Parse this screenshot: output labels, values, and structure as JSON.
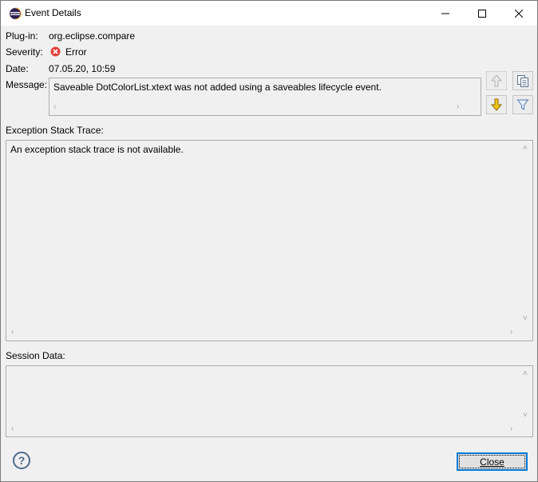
{
  "window": {
    "title": "Event Details",
    "minimize_icon": "minimize-icon",
    "maximize_icon": "maximize-icon",
    "close_icon": "close-x-icon"
  },
  "fields": {
    "plugin_label": "Plug-in:",
    "plugin_value": "org.eclipse.compare",
    "severity_label": "Severity:",
    "severity_value": "Error",
    "date_label": "Date:",
    "date_value": "07.05.20, 10:59",
    "message_label": "Message:",
    "message_value": "Saveable DotColorList.xtext was not added using a saveables lifecycle event."
  },
  "toolbar": {
    "previous_icon": "arrow-up-icon",
    "copy_icon": "copy-icon",
    "next_icon": "arrow-down-icon",
    "filter_icon": "filter-icon"
  },
  "stack_trace": {
    "label": "Exception Stack Trace:",
    "text": "An exception stack trace is not available."
  },
  "session": {
    "label": "Session Data:",
    "text": ""
  },
  "footer": {
    "close_label": "Close"
  },
  "colors": {
    "error_red": "#e0413a",
    "down_arrow_yellow": "#f5c518",
    "focus_blue": "#0078d7"
  }
}
